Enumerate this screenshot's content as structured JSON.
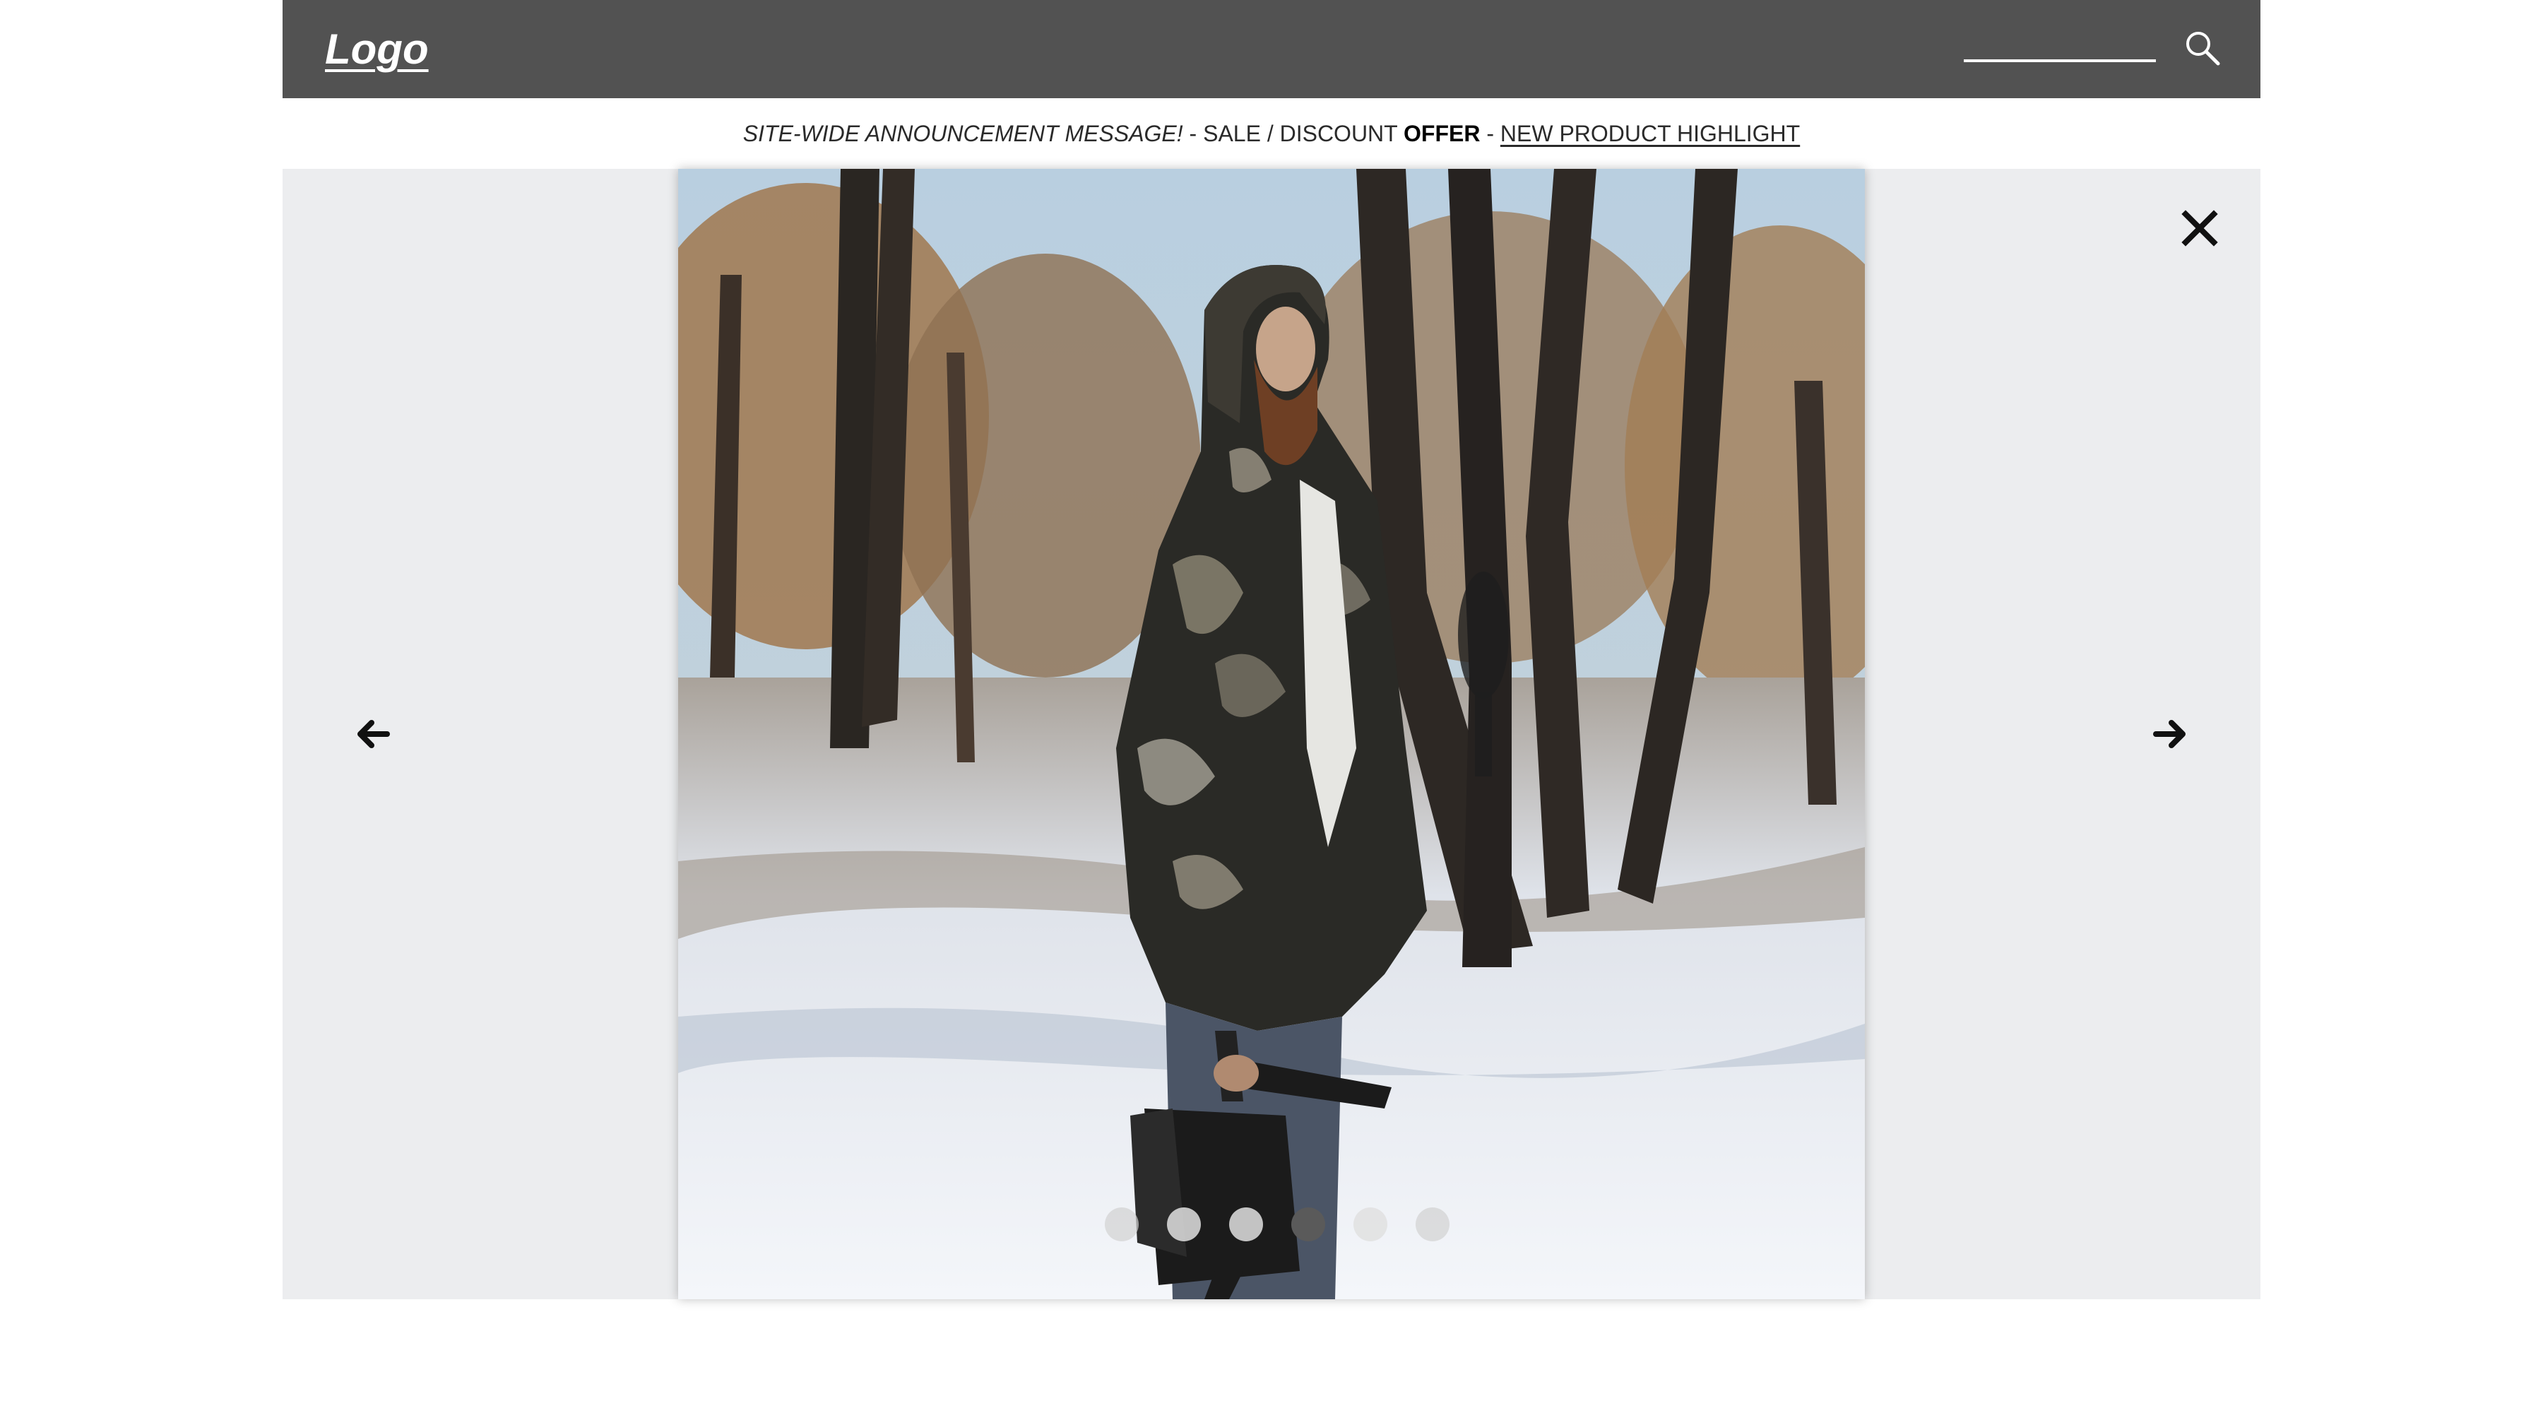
{
  "header": {
    "logo_text": "Logo",
    "search": {
      "value": "",
      "placeholder": ""
    },
    "search_icon": "search-icon"
  },
  "announcement": {
    "part1": "SITE-WIDE ANNOUNCEMENT MESSAGE!",
    "sep1": " - SALE / DISCOUNT ",
    "offer": "OFFER",
    "sep2": " - ",
    "link": "NEW PRODUCT HIGHLIGHT"
  },
  "gallery": {
    "prev_icon": "arrow-left-icon",
    "next_icon": "arrow-right-icon",
    "close_icon": "close-icon",
    "slide_count": 6,
    "active_slide": 4
  },
  "colors": {
    "header_bg": "#525252",
    "gallery_bg": "#ecedef",
    "dot_active": "#5a5a5a",
    "dot_inactive": "#e1e1e1"
  }
}
